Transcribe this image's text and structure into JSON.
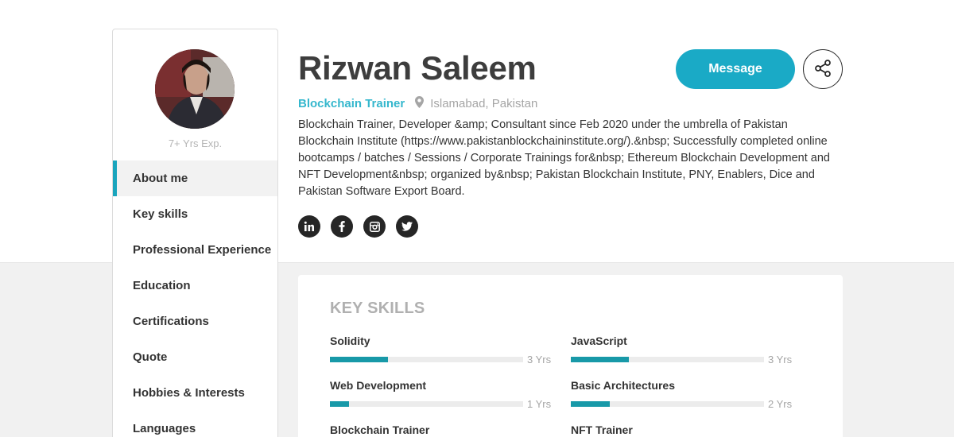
{
  "profile": {
    "name": "Rizwan Saleem",
    "role": "Blockchain Trainer",
    "location": "Islamabad, Pakistan",
    "experience": "7+ Yrs Exp.",
    "bio": "Blockchain Trainer, Developer &amp; Consultant since Feb 2020 under the umbrella of Pakistan Blockchain Institute (https://www.pakistanblockchaininstitute.org/).&nbsp; Successfully completed online bootcamps / batches / Sessions / Corporate Trainings for&nbsp; Ethereum Blockchain Development and NFT Development&nbsp; organized by&nbsp; Pakistan Blockchain Institute, PNY, Enablers, Dice and Pakistan Software Export Board."
  },
  "actions": {
    "message_label": "Message"
  },
  "socials": [
    "linkedin-icon",
    "facebook-icon",
    "instagram-icon",
    "twitter-icon"
  ],
  "sidebar": {
    "items": [
      {
        "label": "About me"
      },
      {
        "label": "Key skills"
      },
      {
        "label": "Professional Experience"
      },
      {
        "label": "Education"
      },
      {
        "label": "Certifications"
      },
      {
        "label": "Quote"
      },
      {
        "label": "Hobbies & Interests"
      },
      {
        "label": "Languages"
      }
    ]
  },
  "skills": {
    "title": "KEY SKILLS",
    "items": [
      {
        "name": "Solidity",
        "years": "3 Yrs",
        "level": 0.3
      },
      {
        "name": "JavaScript",
        "years": "3 Yrs",
        "level": 0.3
      },
      {
        "name": "Web Development",
        "years": "1 Yrs",
        "level": 0.1
      },
      {
        "name": "Basic Architectures",
        "years": "2 Yrs",
        "level": 0.2
      },
      {
        "name": "Blockchain Trainer",
        "years": "",
        "level": 0
      },
      {
        "name": "NFT Trainer",
        "years": "",
        "level": 0
      }
    ]
  },
  "colors": {
    "accent": "#1aaac6",
    "bar": "#1899a8",
    "role": "#35b7cd"
  }
}
